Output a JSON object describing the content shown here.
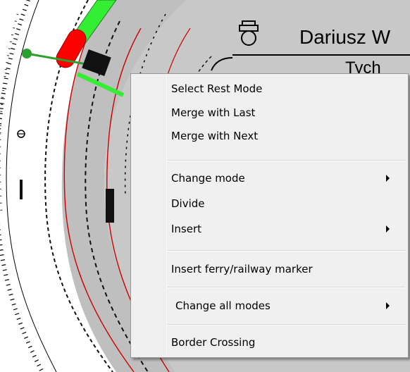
{
  "background": {
    "header_text": "Dariusz W",
    "header_text_2": "Tych",
    "colors": {
      "red": "#ff0000",
      "green": "#33ee33",
      "gray_band": "#bfbfbf",
      "red_circle": "#cc0000"
    }
  },
  "menu": {
    "items": [
      {
        "label": "Select Rest Mode",
        "submenu": false
      },
      {
        "label": "Merge with Last",
        "submenu": false
      },
      {
        "label": "Merge with Next",
        "submenu": false
      },
      {
        "label": "Change mode",
        "submenu": true
      },
      {
        "label": "Divide",
        "submenu": false
      },
      {
        "label": "Insert",
        "submenu": true
      },
      {
        "label": "Insert ferry/railway marker",
        "submenu": false
      },
      {
        "label": "Change all modes",
        "submenu": true
      },
      {
        "label": "Border Crossing",
        "submenu": false
      }
    ]
  }
}
